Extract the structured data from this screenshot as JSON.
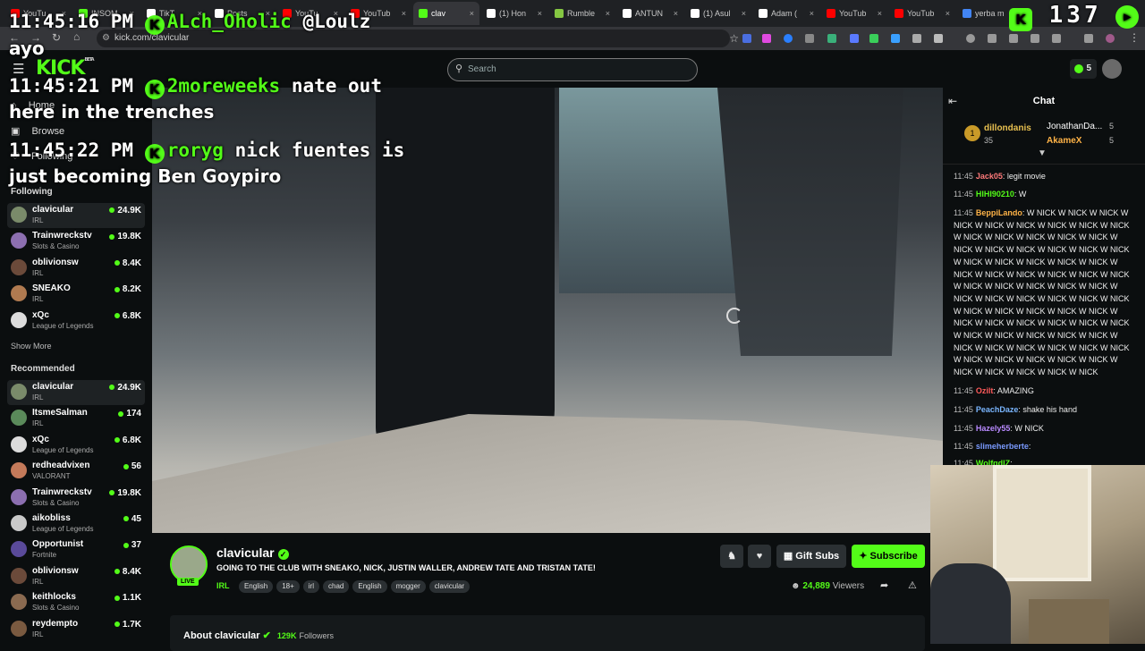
{
  "tabs": [
    {
      "label": "YouTu",
      "color": "#ff0000"
    },
    {
      "label": "INSOM",
      "color": "#53fc18"
    },
    {
      "label": "TikT",
      "color": "#ffffff"
    },
    {
      "label": "Posts",
      "color": "#ffffff"
    },
    {
      "label": "YouTu",
      "color": "#ff0000"
    },
    {
      "label": "YouTub",
      "color": "#ff0000"
    },
    {
      "label": "clav",
      "color": "#53fc18"
    },
    {
      "label": "(1) Hon",
      "color": "#ffffff"
    },
    {
      "label": "Rumble",
      "color": "#85c742"
    },
    {
      "label": "ANTUN",
      "color": "#ffffff"
    },
    {
      "label": "(1) Asul",
      "color": "#ffffff"
    },
    {
      "label": "Adam (",
      "color": "#ffffff"
    },
    {
      "label": "YouTub",
      "color": "#ff0000"
    },
    {
      "label": "YouTub",
      "color": "#ff0000"
    },
    {
      "label": "yerba m",
      "color": "#4285f4"
    }
  ],
  "url": "kick.com/clavicular",
  "overlay": {
    "lines": [
      {
        "time": "11:45:16 PM",
        "user": "ALch_Oholic",
        "text": "@Loulz"
      },
      {
        "text": "ayo"
      },
      {
        "time": "11:45:21 PM",
        "user": "2moreweeks",
        "text": "nate out"
      },
      {
        "text": "here in the trenches"
      },
      {
        "time": "11:45:22 PM",
        "user": "roryg",
        "text": "nick fuentes is"
      },
      {
        "text": "just becoming Ben Goypiro"
      }
    ],
    "counter": "137",
    "counter2": "1"
  },
  "header": {
    "logo": "KICK",
    "logo_beta": "BETA",
    "search_placeholder": "Search",
    "kick_count": "5"
  },
  "sidebar": {
    "nav_home": "Home",
    "nav_browse": "Browse",
    "nav_following": "Following",
    "following_title": "Following",
    "following": [
      {
        "name": "clavicular",
        "cat": "IRL",
        "viewers": "24.9K",
        "color": "#7a8b6a"
      },
      {
        "name": "Trainwreckstv",
        "cat": "Slots & Casino",
        "viewers": "19.8K",
        "color": "#8c6fb0"
      },
      {
        "name": "oblivionsw",
        "cat": "IRL",
        "viewers": "8.4K",
        "color": "#6b4a3a"
      },
      {
        "name": "SNEAKO",
        "cat": "IRL",
        "viewers": "8.2K",
        "color": "#b07a50"
      },
      {
        "name": "xQc",
        "cat": "League of Legends",
        "viewers": "6.8K",
        "color": "#dcdcdc"
      }
    ],
    "show_more": "Show More",
    "recommended_title": "Recommended",
    "recommended": [
      {
        "name": "clavicular",
        "cat": "IRL",
        "viewers": "24.9K",
        "color": "#7a8b6a"
      },
      {
        "name": "ItsmeSalman",
        "cat": "IRL",
        "viewers": "174",
        "color": "#5a8a5a"
      },
      {
        "name": "xQc",
        "cat": "League of Legends",
        "viewers": "6.8K",
        "color": "#dcdcdc"
      },
      {
        "name": "redheadvixen",
        "cat": "VALORANT",
        "viewers": "56",
        "color": "#c47a5a"
      },
      {
        "name": "Trainwreckstv",
        "cat": "Slots & Casino",
        "viewers": "19.8K",
        "color": "#8c6fb0"
      },
      {
        "name": "aikobliss",
        "cat": "League of Legends",
        "viewers": "45",
        "color": "#c9c9c9"
      },
      {
        "name": "Opportunist",
        "cat": "Fortnite",
        "viewers": "37",
        "color": "#5a4a9a"
      },
      {
        "name": "oblivionsw",
        "cat": "IRL",
        "viewers": "8.4K",
        "color": "#6b4a3a"
      },
      {
        "name": "keithlocks",
        "cat": "Slots & Casino",
        "viewers": "1.1K",
        "color": "#8a6a50"
      },
      {
        "name": "reydempto",
        "cat": "IRL",
        "viewers": "1.7K",
        "color": "#7a5a40"
      }
    ]
  },
  "stream": {
    "channel": "clavicular",
    "live": "LIVE",
    "title": "GOING TO THE CLUB WITH SNEAKO, NICK, JUSTIN WALLER, ANDREW TATE AND TRISTAN TATE!",
    "category": "IRL",
    "tags": [
      "English",
      "18+",
      "irl",
      "chad",
      "English",
      "mogger",
      "clavicular"
    ],
    "viewers": "24,889",
    "viewers_label": "Viewers",
    "gift_label": "Gift Subs",
    "subscribe_label": "Subscribe",
    "about_title": "About clavicular",
    "followers": "129K",
    "followers_label": "Followers"
  },
  "chat": {
    "title": "Chat",
    "top_gifters": [
      {
        "rank": "1",
        "name": "dillondanis",
        "count": "35"
      },
      {
        "name": "JonathanDa...",
        "count": "5"
      },
      {
        "name": "AkameX",
        "count": "5"
      }
    ],
    "messages": [
      {
        "time": "11:45",
        "user": "Jack05",
        "color": "#ff7a7a",
        "text": "legit movie"
      },
      {
        "time": "11:45",
        "user": "HIHI90210",
        "color": "#53fc18",
        "text": "W"
      },
      {
        "time": "11:45",
        "user": "BeppiLando",
        "color": "#ffb347",
        "text": "W NICK W NICK W NICK W NICK W NICK W NICK W NICK W NICK W NICK W NICK W NICK W NICK W NICK W NICK W NICK W NICK W NICK W NICK W NICK W NICK W NICK W NICK W NICK W NICK W NICK W NICK W NICK W NICK W NICK W NICK W NICK W NICK W NICK W NICK W NICK W NICK W NICK W NICK W NICK W NICK W NICK W NICK W NICK W NICK W NICK W NICK W NICK W NICK W NICK W NICK W NICK W NICK W NICK W NICK W NICK W NICK W NICK W NICK W NICK W NICK W NICK W NICK W NICK W NICK W NICK W NICK W NICK W NICK W NICK W NICK W NICK W NICK W NICK W NICK"
      },
      {
        "time": "11:45",
        "user": "Ozilt",
        "color": "#ff5a5a",
        "text": "AMAZING"
      },
      {
        "time": "11:45",
        "user": "PeachDaze",
        "color": "#7ab6ff",
        "text": "shake his hand"
      },
      {
        "time": "11:45",
        "user": "Hazely55",
        "color": "#b98aff",
        "text": "W NICK"
      },
      {
        "time": "11:45",
        "user": "slimeherberte",
        "color": "#7a9aff",
        "text": ""
      },
      {
        "time": "11:45",
        "user": "WolfgdlZ",
        "color": "#53fc18",
        "text": ""
      }
    ]
  }
}
